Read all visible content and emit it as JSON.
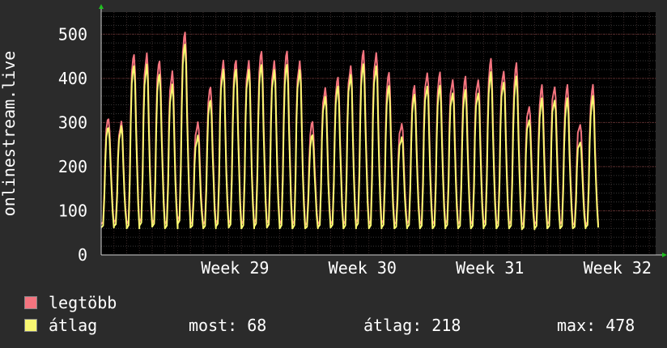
{
  "chart_data": {
    "type": "line",
    "ylabel": "onlinestream.live",
    "ylim": [
      0,
      550
    ],
    "yticks": [
      0,
      100,
      200,
      300,
      400,
      500
    ],
    "week_labels": [
      "Week 29",
      "Week 30",
      "Week 31",
      "Week 32"
    ],
    "week_label_day": [
      10.5,
      20.5,
      30.5,
      40.5
    ],
    "days": 43.5,
    "grid": true,
    "legend_placement": "bottom-left",
    "series": [
      {
        "name": "legtöbb",
        "color": "#f4747f",
        "daily_peak": [
          310,
          300,
          455,
          455,
          440,
          415,
          505,
          300,
          380,
          440,
          440,
          440,
          460,
          440,
          460,
          440,
          300,
          380,
          400,
          430,
          460,
          460,
          410,
          300,
          380,
          415,
          410,
          400,
          400,
          400,
          440,
          420,
          430,
          340,
          380,
          385,
          380,
          300,
          380
        ],
        "night_min": [
          70,
          75,
          70,
          75,
          72,
          70,
          80,
          70,
          70,
          72,
          72,
          70,
          74,
          72,
          70,
          70,
          68,
          70,
          70,
          70,
          74,
          70,
          72,
          70,
          72,
          70,
          70,
          72,
          70,
          70,
          72,
          70,
          70,
          68,
          70,
          70,
          70,
          68,
          68
        ]
      },
      {
        "name": "átlag",
        "color": "#f9f871",
        "daily_peak": [
          290,
          290,
          430,
          430,
          410,
          385,
          478,
          270,
          350,
          420,
          420,
          420,
          430,
          420,
          430,
          420,
          270,
          360,
          380,
          410,
          430,
          430,
          380,
          270,
          360,
          385,
          380,
          370,
          370,
          370,
          410,
          395,
          400,
          310,
          350,
          355,
          350,
          260,
          355
        ],
        "night_min": [
          62,
          65,
          60,
          66,
          64,
          60,
          70,
          62,
          60,
          64,
          62,
          60,
          64,
          62,
          60,
          60,
          60,
          62,
          62,
          60,
          64,
          60,
          62,
          60,
          62,
          60,
          60,
          62,
          60,
          60,
          62,
          60,
          60,
          58,
          60,
          60,
          60,
          60,
          62
        ]
      }
    ]
  },
  "legend": {
    "max_label": "legtöbb",
    "avg_label": "átlag",
    "max_color": "#f4747f",
    "avg_color": "#f9f871"
  },
  "stats": {
    "now": "most: 68",
    "avg": "átlag: 218",
    "max": "max: 478"
  }
}
